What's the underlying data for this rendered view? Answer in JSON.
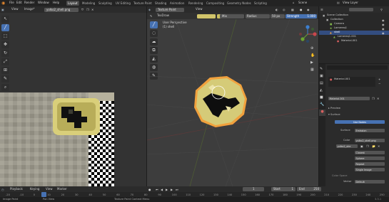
{
  "menu": {
    "items": [
      "File",
      "Edit",
      "Render",
      "Window",
      "Help"
    ],
    "workspaces": [
      "Layout",
      "Modeling",
      "Sculpting",
      "UV Editing",
      "Texture Paint",
      "Shading",
      "Animation",
      "Rendering",
      "Compositing",
      "Geometry Nodes",
      "Scripting"
    ],
    "active_workspace": "Layout",
    "scene_label": "Scene",
    "view_layer_label": "View Layer"
  },
  "image_editor": {
    "view_menu": "View",
    "image_menu": "Image*",
    "image_name": "yolko2_shell.png",
    "tools": [
      "pointer",
      "brush",
      "select-box",
      "move",
      "rotate",
      "scale",
      "transform",
      "annotate",
      "eyedropper"
    ]
  },
  "viewport": {
    "mode": "Texture Paint",
    "view_menu": "View",
    "brush_name": "TexDraw",
    "blend": "Mix",
    "radius_label": "Radius",
    "radius_value": "50 px",
    "strength_label": "Strength",
    "strength_value": "1.000",
    "overlay_title": "User Perspective",
    "overlay_object": "(1) shell",
    "gizmo_axes": [
      "X",
      "Y",
      "Z"
    ]
  },
  "outliner": {
    "title": "Scene Collection",
    "rows": [
      {
        "label": "Scene Collection",
        "depth": 0
      },
      {
        "label": "Collection",
        "depth": 1
      },
      {
        "label": "Camera",
        "depth": 2
      },
      {
        "label": "Lamereq1",
        "depth": 2
      },
      {
        "label": "shell",
        "depth": 2
      },
      {
        "label": "Lamereq1.001",
        "depth": 3
      },
      {
        "label": "Material.001",
        "depth": 4
      }
    ]
  },
  "properties": {
    "material_slot": "Material.001",
    "material_name": "Material.001",
    "preview_label": "Preview",
    "surface_label": "Surface",
    "surface_value": "Use Nodes",
    "surface_field_label": "Surface",
    "surface_field_value": "Emission",
    "color_label": "Color",
    "color_value": "yolko2_shell.png",
    "image_field": "yolko2_she",
    "options": [
      "Closest",
      "Sphere",
      "Repeat",
      "Single Image"
    ],
    "vector_label": "Vector",
    "vector_value": "Default",
    "strength_label": "Strength",
    "strength_value": "1.000",
    "color_space_label": "Color Space"
  },
  "timeline": {
    "menus": [
      "Playback",
      "Keying",
      "View",
      "Marker"
    ],
    "frames": [
      "-20",
      "-10",
      "0",
      "10",
      "20",
      "30",
      "40",
      "50",
      "60",
      "70",
      "80",
      "90",
      "100",
      "110",
      "120",
      "130",
      "140",
      "150",
      "160",
      "170",
      "180",
      "190",
      "200",
      "210",
      "220",
      "230",
      "240",
      "250"
    ],
    "current_frame": "1",
    "start_label": "Start",
    "start_value": "1",
    "end_label": "End",
    "end_value": "250"
  },
  "status": {
    "left": "Image Paint",
    "middle_1": "Pan View",
    "middle_2": "Texture Paint Context Menu",
    "version": "3.3.1"
  },
  "colors": {
    "accent": "#4772b3",
    "header": "#2b2b2b",
    "viewport_bg": "#3d3d3d",
    "active_object": "#f1a13d",
    "egg_yellow": "#d9cf7a"
  }
}
